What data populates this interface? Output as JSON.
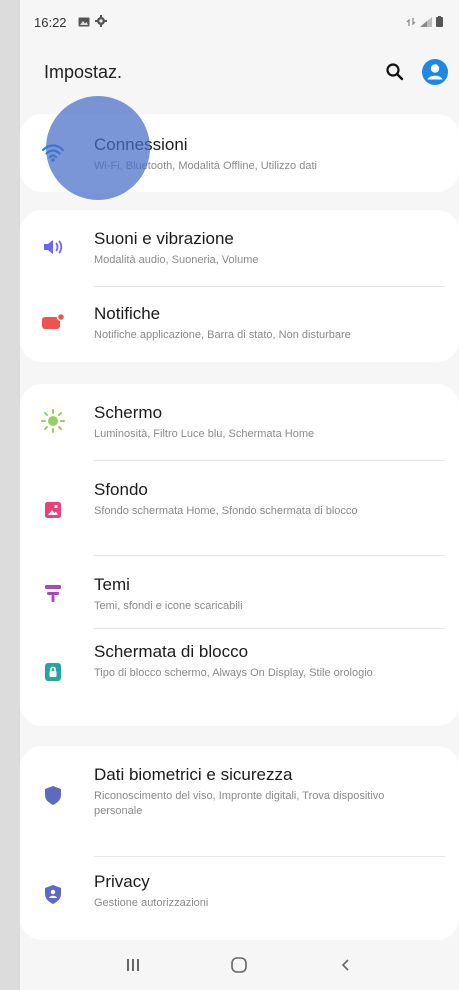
{
  "status": {
    "time": "16:22"
  },
  "header": {
    "title": "Impostaz."
  },
  "colors": {
    "accent": "#1e88e5",
    "wifi": "#1e88e5",
    "sound": "#6c63ff",
    "notify": "#ef5350",
    "display": "#9ccc65",
    "wallpaper": "#ec407a",
    "themes": "#ab47bc",
    "lock": "#26a69a",
    "biometric": "#5c6bc0",
    "privacy": "#5c6bc0"
  },
  "groups": [
    {
      "items": [
        {
          "icon": "wifi-icon",
          "title": "Connessioni",
          "subtitle": "Wi-Fi, Bluetooth, Modalità Offline, Utilizzo dati"
        }
      ]
    },
    {
      "items": [
        {
          "icon": "volume-icon",
          "title": "Suoni e vibrazione",
          "subtitle": "Modalità audio, Suoneria, Volume"
        },
        {
          "icon": "notification-icon",
          "title": "Notifiche",
          "subtitle": "Notifiche applicazione, Barra di stato, Non disturbare"
        }
      ]
    },
    {
      "items": [
        {
          "icon": "brightness-icon",
          "title": "Schermo",
          "subtitle": "Luminosità, Filtro Luce blu, Schermata Home"
        },
        {
          "icon": "wallpaper-icon",
          "title": "Sfondo",
          "subtitle": "Sfondo schermata Home, Sfondo schermata di blocco"
        },
        {
          "icon": "themes-icon",
          "title": "Temi",
          "subtitle": "Temi, sfondi e icone scaricabili"
        },
        {
          "icon": "lock-icon",
          "title": "Schermata di blocco",
          "subtitle": "Tipo di blocco schermo, Always On Display, Stile orologio"
        }
      ]
    },
    {
      "items": [
        {
          "icon": "shield-icon",
          "title": "Dati biometrici e sicurezza",
          "subtitle": "Riconoscimento del viso, Impronte digitali, Trova dispositivo personale"
        },
        {
          "icon": "privacy-icon",
          "title": "Privacy",
          "subtitle": "Gestione autorizzazioni"
        }
      ]
    }
  ]
}
